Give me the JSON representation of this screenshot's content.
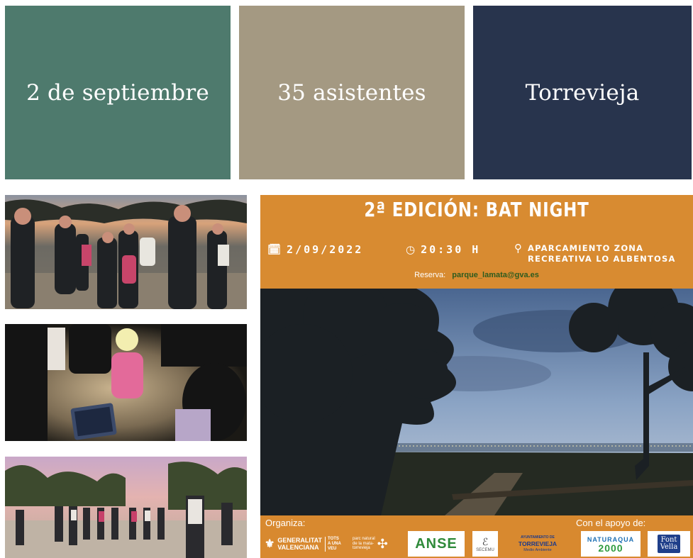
{
  "stats": {
    "date": "2 de septiembre",
    "attendees": "35 asistentes",
    "location": "Torrevieja"
  },
  "poster": {
    "title": "2ª EDICIÓN: BAT NIGHT",
    "date": "2/09/2022",
    "time": "20:30 H",
    "place_line1": "APARCAMIENTO ZONA",
    "place_line2": "RECREATIVA LO ALBENTOSA",
    "reserve_label": "Reserva:",
    "reserve_email": "parque_lamata@gva.es",
    "organiza_label": "Organiza:",
    "apoyo_label": "Con el apoyo de:",
    "logos": {
      "gva_line1": "GENERALITAT",
      "gva_line2": "VALENCIANA",
      "gva_tag1": "TOTS",
      "gva_tag2": "A UNA",
      "gva_tag3": "VEU",
      "parc_line1": "parc natural",
      "parc_line2": "de la mata-",
      "parc_line3": "torrevieja",
      "anse": "ANSE",
      "secemu": "SECEMU",
      "torrevieja_line1": "AYUNTAMIENTO DE",
      "torrevieja_line2": "TORREVIEJA",
      "torrevieja_line3": "Medio Ambiente",
      "natura_top": "NATURAQUA",
      "natura_num": "2000",
      "fontvella_1": "Font",
      "fontvella_2": "Vella"
    },
    "colors": {
      "header": "#d88b31",
      "email": "#2d5b1e"
    }
  },
  "colors": {
    "tile_date": "#4e7a6d",
    "tile_attendees": "#a49982",
    "tile_location": "#28344d"
  },
  "icons": {
    "calendar": "calendar-icon",
    "clock": "clock-icon",
    "pin": "map-pin-icon"
  }
}
